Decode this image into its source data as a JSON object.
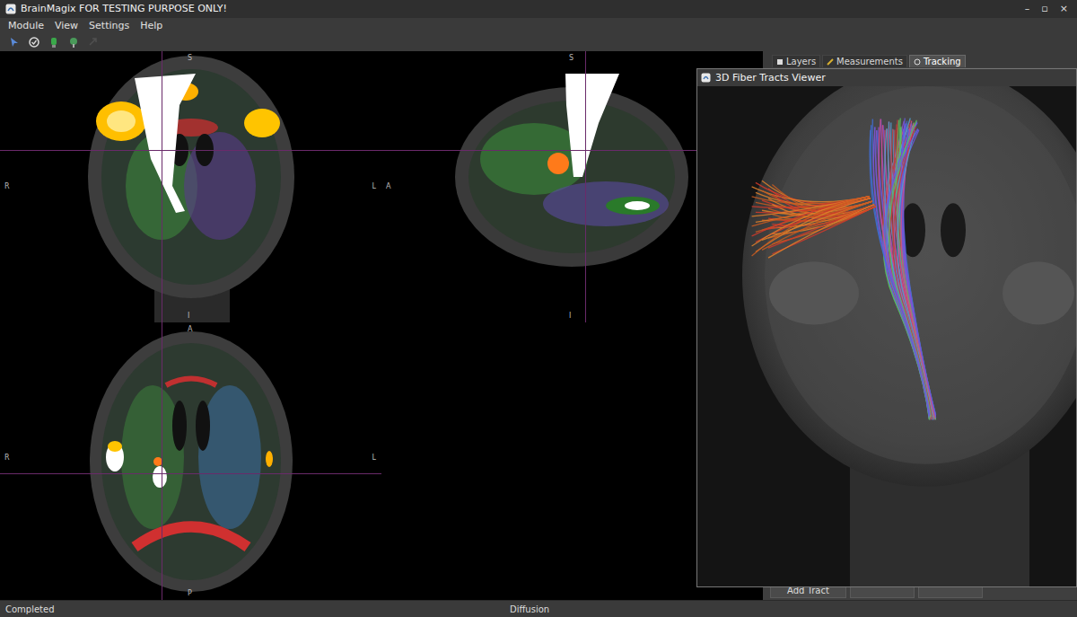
{
  "window": {
    "title": "BrainMagix FOR TESTING PURPOSE ONLY!",
    "controls": [
      "–",
      "▫",
      "×"
    ]
  },
  "menu": [
    "Module",
    "View",
    "Settings",
    "Help"
  ],
  "toolbar": [
    {
      "disabled": false
    },
    {
      "disabled": false
    },
    {
      "disabled": false
    },
    {
      "disabled": false
    },
    {
      "disabled": true
    }
  ],
  "views": [
    {
      "name": "coronal",
      "labels": [
        {
          "text": "S",
          "pos": "top"
        },
        {
          "text": "R",
          "pos": "left"
        },
        {
          "text": "L",
          "pos": "right"
        },
        {
          "text": "I",
          "pos": "bottom"
        }
      ]
    },
    {
      "name": "sagittal",
      "labels": [
        {
          "text": "S",
          "pos": "top"
        },
        {
          "text": "A",
          "pos": "left"
        },
        {
          "text": "I",
          "pos": "bottom"
        }
      ]
    },
    {
      "name": "axial",
      "labels": [
        {
          "text": "A",
          "pos": "top"
        },
        {
          "text": "R",
          "pos": "left"
        },
        {
          "text": "L",
          "pos": "right"
        },
        {
          "text": "P",
          "pos": "bottom"
        }
      ]
    }
  ],
  "side_tabs": [
    {
      "label": "Layers",
      "selected": false
    },
    {
      "label": "Measurements",
      "selected": false
    },
    {
      "label": "Tracking",
      "selected": true
    }
  ],
  "viewer": {
    "title": "3D Fiber Tracts Viewer"
  },
  "panel_buttons": [
    {
      "label": "Add Tract"
    }
  ],
  "status_bar": {
    "left": "Completed",
    "center": "Diffusion"
  }
}
